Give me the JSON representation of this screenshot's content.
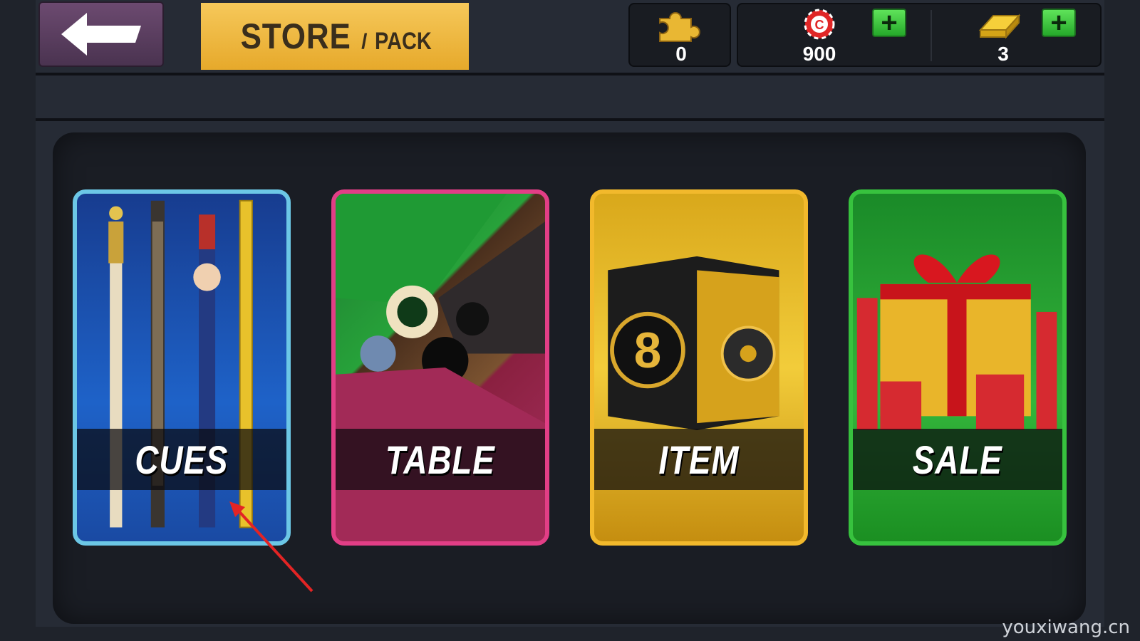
{
  "header": {
    "back_icon": "back-arrow-icon",
    "title_main": "STORE",
    "title_separator": "/",
    "title_sub": "PACK"
  },
  "currencies": {
    "puzzle": {
      "icon": "puzzle-piece-icon",
      "value": "0"
    },
    "chips": {
      "icon": "casino-chip-icon",
      "value": "900",
      "add_label": "+"
    },
    "gold": {
      "icon": "gold-bar-icon",
      "value": "3",
      "add_label": "+"
    }
  },
  "categories": [
    {
      "label": "CUES",
      "color": "#6cc7e6"
    },
    {
      "label": "TABLE",
      "color": "#e23e86"
    },
    {
      "label": "ITEM",
      "color": "#f2b92c"
    },
    {
      "label": "SALE",
      "color": "#37c23e"
    }
  ],
  "watermark": "youxiwang.cn"
}
